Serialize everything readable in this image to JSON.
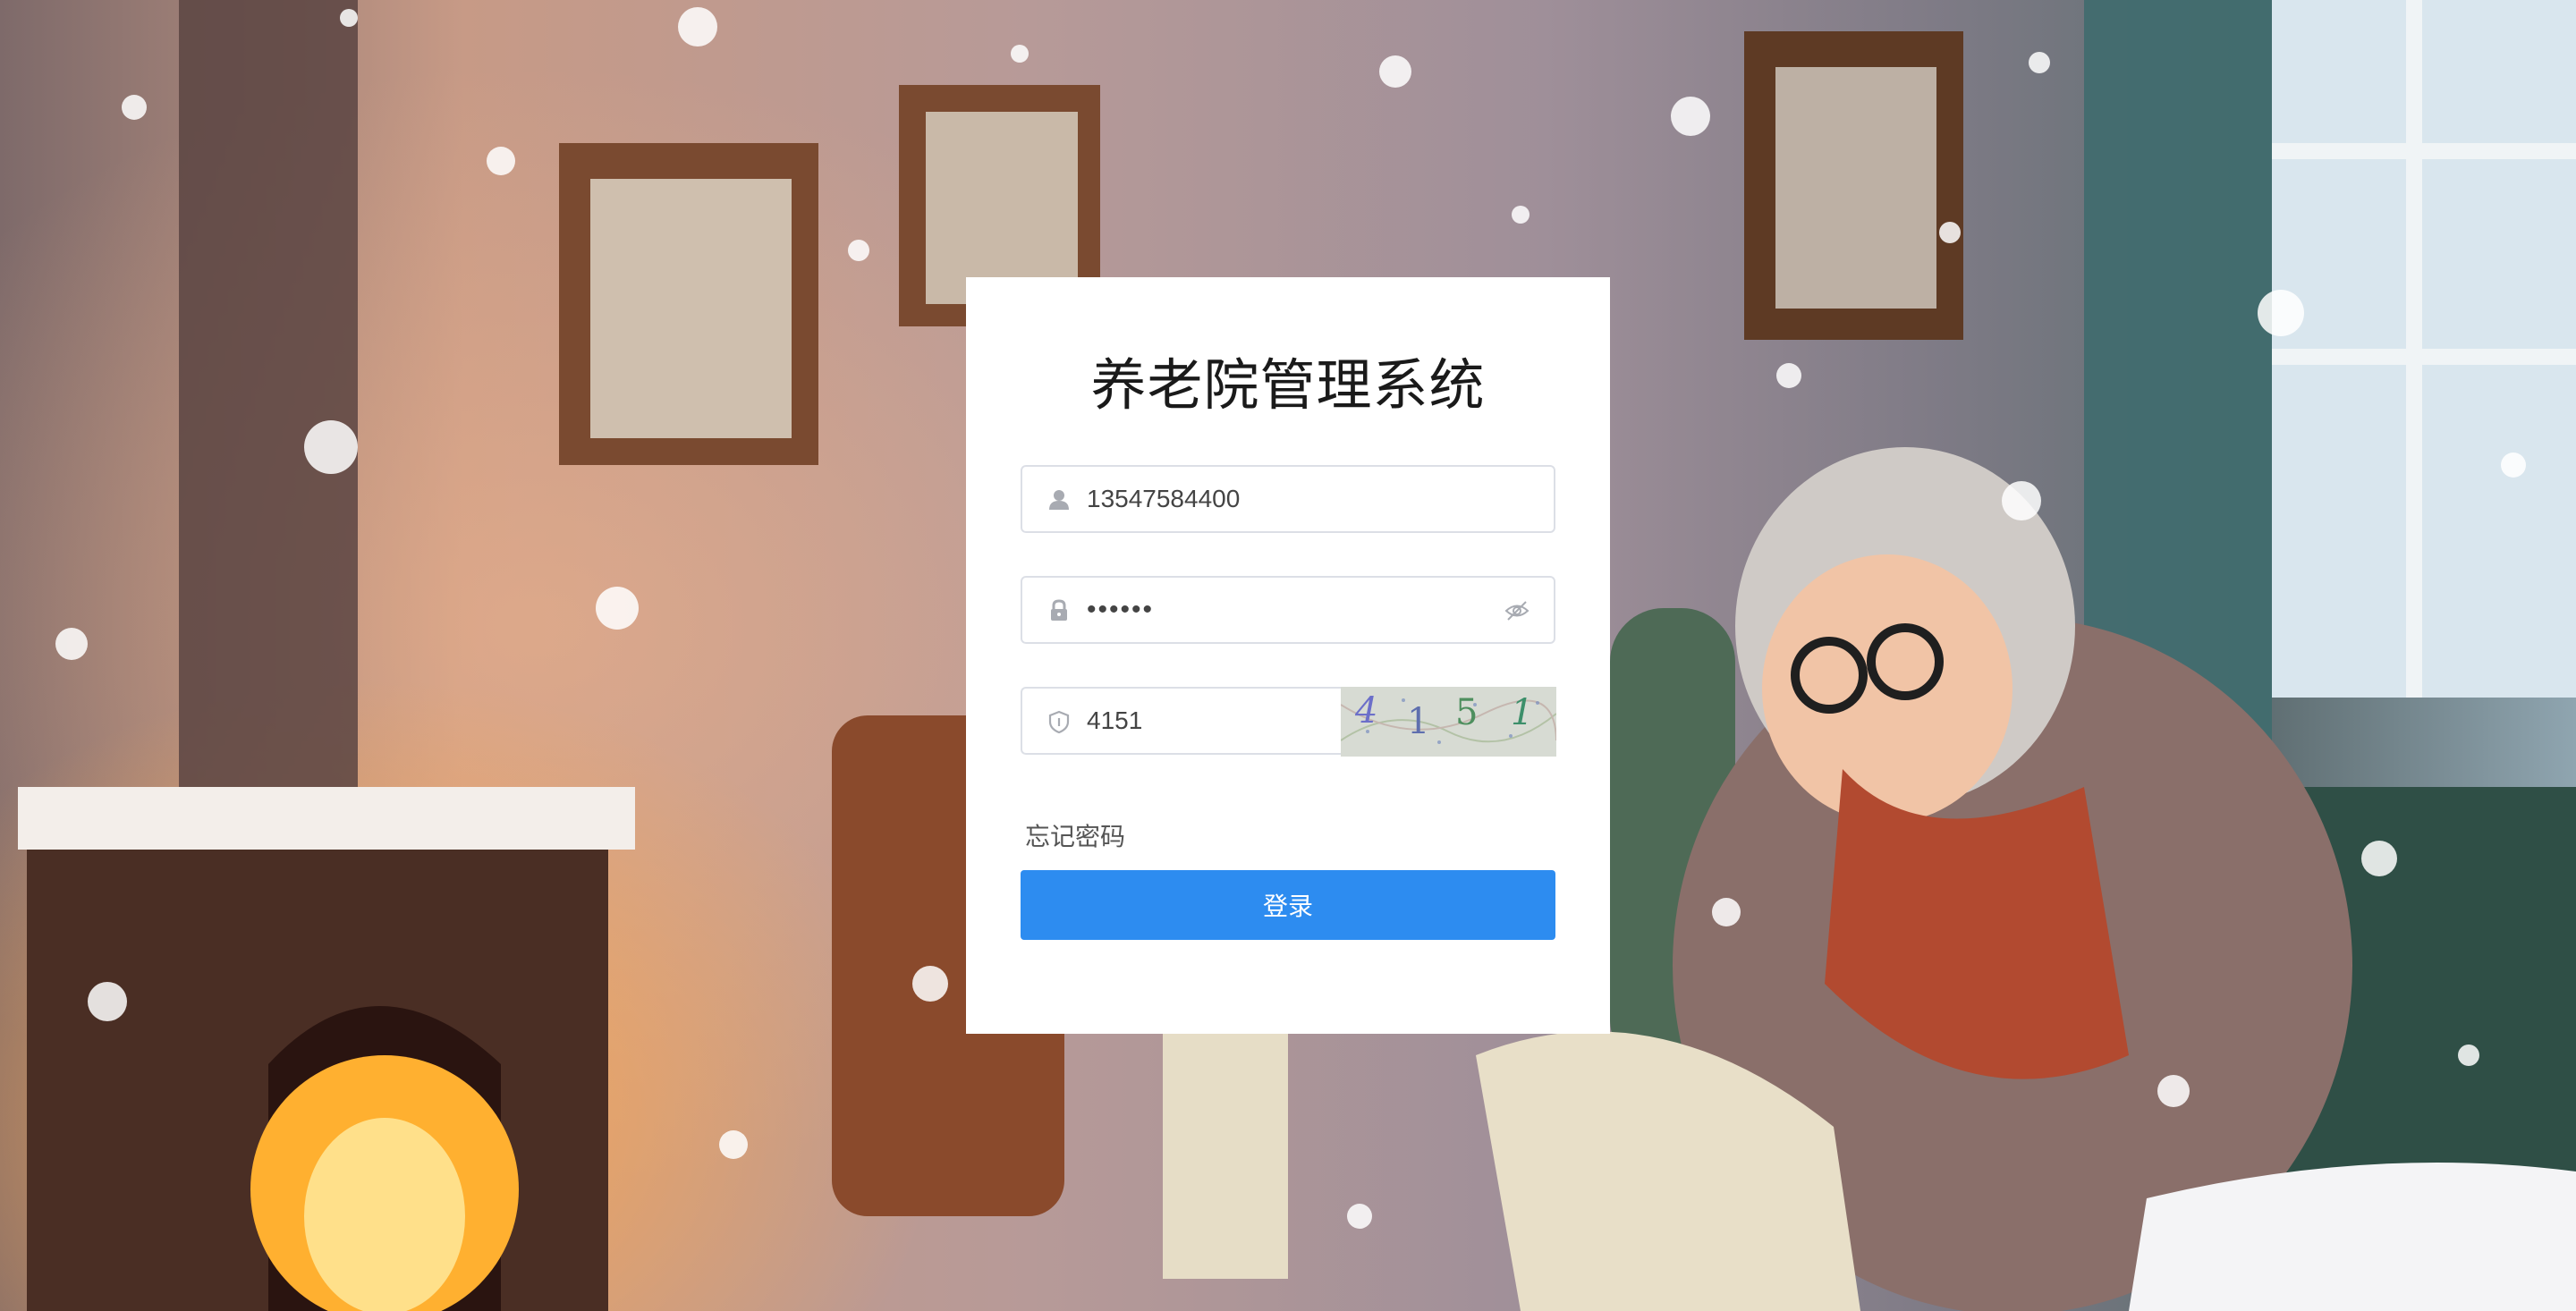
{
  "app": {
    "title": "养老院管理系统"
  },
  "login": {
    "username_value": "13547584400",
    "password_value": "••••••",
    "captcha_input_value": "4151",
    "captcha_image_text": [
      "4",
      "1",
      "5",
      "1"
    ],
    "forgot_password_label": "忘记密码",
    "submit_label": "登录"
  },
  "icons": {
    "username": "user-icon",
    "password": "lock-icon",
    "toggle_visibility": "eye-off-icon",
    "captcha": "shield-icon"
  },
  "colors": {
    "primary": "#2d8cf0",
    "card_background": "#ffffff",
    "input_border": "#dcdfe6"
  }
}
